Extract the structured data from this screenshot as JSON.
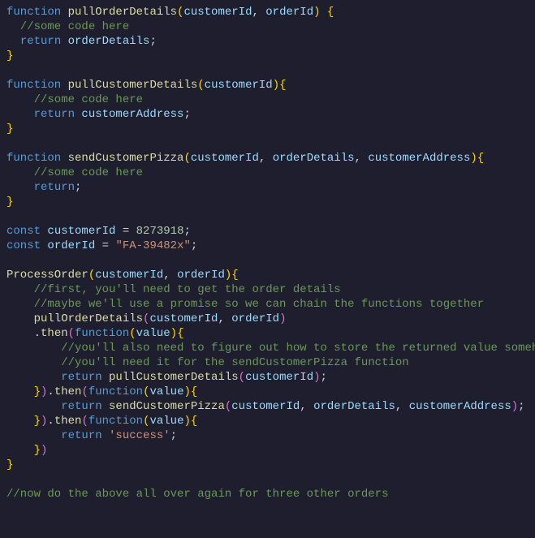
{
  "tokens": [
    [
      {
        "t": "function ",
        "c": "tok-kw"
      },
      {
        "t": "pullOrderDetails",
        "c": "tok-fn"
      },
      {
        "t": "(",
        "c": "tok-gold"
      },
      {
        "t": "customerId",
        "c": "tok-par"
      },
      {
        "t": ", ",
        "c": "tok-pun"
      },
      {
        "t": "orderId",
        "c": "tok-par"
      },
      {
        "t": ") ",
        "c": "tok-gold"
      },
      {
        "t": "{",
        "c": "tok-gold"
      }
    ],
    [
      {
        "t": "  //some code here",
        "c": "tok-com"
      }
    ],
    [
      {
        "t": "  ",
        "c": "tok-pun"
      },
      {
        "t": "return ",
        "c": "tok-kw"
      },
      {
        "t": "orderDetails",
        "c": "tok-par"
      },
      {
        "t": ";",
        "c": "tok-pun"
      }
    ],
    [
      {
        "t": "}",
        "c": "tok-gold"
      }
    ],
    [
      {
        "t": "",
        "c": "tok-pun"
      }
    ],
    [
      {
        "t": "function ",
        "c": "tok-kw"
      },
      {
        "t": "pullCustomerDetails",
        "c": "tok-fn"
      },
      {
        "t": "(",
        "c": "tok-gold"
      },
      {
        "t": "customerId",
        "c": "tok-par"
      },
      {
        "t": ")",
        "c": "tok-gold"
      },
      {
        "t": "{",
        "c": "tok-gold"
      }
    ],
    [
      {
        "t": "    //some code here",
        "c": "tok-com"
      }
    ],
    [
      {
        "t": "    ",
        "c": "tok-pun"
      },
      {
        "t": "return ",
        "c": "tok-kw"
      },
      {
        "t": "customerAddress",
        "c": "tok-par"
      },
      {
        "t": ";",
        "c": "tok-pun"
      }
    ],
    [
      {
        "t": "}",
        "c": "tok-gold"
      }
    ],
    [
      {
        "t": "",
        "c": "tok-pun"
      }
    ],
    [
      {
        "t": "function ",
        "c": "tok-kw"
      },
      {
        "t": "sendCustomerPizza",
        "c": "tok-fn"
      },
      {
        "t": "(",
        "c": "tok-gold"
      },
      {
        "t": "customerId",
        "c": "tok-par"
      },
      {
        "t": ", ",
        "c": "tok-pun"
      },
      {
        "t": "orderDetails",
        "c": "tok-par"
      },
      {
        "t": ", ",
        "c": "tok-pun"
      },
      {
        "t": "customerAddress",
        "c": "tok-par"
      },
      {
        "t": ")",
        "c": "tok-gold"
      },
      {
        "t": "{",
        "c": "tok-gold"
      }
    ],
    [
      {
        "t": "    //some code here",
        "c": "tok-com"
      }
    ],
    [
      {
        "t": "    ",
        "c": "tok-pun"
      },
      {
        "t": "return",
        "c": "tok-kw"
      },
      {
        "t": ";",
        "c": "tok-pun"
      }
    ],
    [
      {
        "t": "}",
        "c": "tok-gold"
      }
    ],
    [
      {
        "t": "",
        "c": "tok-pun"
      }
    ],
    [
      {
        "t": "const ",
        "c": "tok-kw"
      },
      {
        "t": "customerId",
        "c": "tok-par"
      },
      {
        "t": " = ",
        "c": "tok-pun"
      },
      {
        "t": "8273918",
        "c": "tok-num"
      },
      {
        "t": ";",
        "c": "tok-pun"
      }
    ],
    [
      {
        "t": "const ",
        "c": "tok-kw"
      },
      {
        "t": "orderId",
        "c": "tok-par"
      },
      {
        "t": " = ",
        "c": "tok-pun"
      },
      {
        "t": "\"FA-39482x\"",
        "c": "tok-str"
      },
      {
        "t": ";",
        "c": "tok-pun"
      }
    ],
    [
      {
        "t": "",
        "c": "tok-pun"
      }
    ],
    [
      {
        "t": "ProcessOrder",
        "c": "tok-fn"
      },
      {
        "t": "(",
        "c": "tok-gold"
      },
      {
        "t": "customerId",
        "c": "tok-par"
      },
      {
        "t": ", ",
        "c": "tok-pun"
      },
      {
        "t": "orderId",
        "c": "tok-par"
      },
      {
        "t": ")",
        "c": "tok-gold"
      },
      {
        "t": "{",
        "c": "tok-gold"
      }
    ],
    [
      {
        "t": "    //first, you'll need to get the order details",
        "c": "tok-com"
      }
    ],
    [
      {
        "t": "    //maybe we'll use a promise so we can chain the functions together",
        "c": "tok-com"
      }
    ],
    [
      {
        "t": "    ",
        "c": "tok-pun"
      },
      {
        "t": "pullOrderDetails",
        "c": "tok-fn"
      },
      {
        "t": "(",
        "c": "tok-pink"
      },
      {
        "t": "customerId",
        "c": "tok-par"
      },
      {
        "t": ", ",
        "c": "tok-pun"
      },
      {
        "t": "orderId",
        "c": "tok-par"
      },
      {
        "t": ")",
        "c": "tok-pink"
      }
    ],
    [
      {
        "t": "    .",
        "c": "tok-pun"
      },
      {
        "t": "then",
        "c": "tok-fn"
      },
      {
        "t": "(",
        "c": "tok-pink"
      },
      {
        "t": "function",
        "c": "tok-kw"
      },
      {
        "t": "(",
        "c": "tok-gold"
      },
      {
        "t": "value",
        "c": "tok-par"
      },
      {
        "t": ")",
        "c": "tok-gold"
      },
      {
        "t": "{",
        "c": "tok-gold"
      }
    ],
    [
      {
        "t": "        //you'll also need to figure out how to store the returned value somehow",
        "c": "tok-com"
      }
    ],
    [
      {
        "t": "        //you'll need it for the sendCustomerPizza function",
        "c": "tok-com"
      }
    ],
    [
      {
        "t": "        ",
        "c": "tok-pun"
      },
      {
        "t": "return ",
        "c": "tok-kw"
      },
      {
        "t": "pullCustomerDetails",
        "c": "tok-fn"
      },
      {
        "t": "(",
        "c": "tok-pink"
      },
      {
        "t": "customerId",
        "c": "tok-par"
      },
      {
        "t": ")",
        "c": "tok-pink"
      },
      {
        "t": ";",
        "c": "tok-pun"
      }
    ],
    [
      {
        "t": "    ",
        "c": "tok-pun"
      },
      {
        "t": "}",
        "c": "tok-gold"
      },
      {
        "t": ")",
        "c": "tok-pink"
      },
      {
        "t": ".",
        "c": "tok-pun"
      },
      {
        "t": "then",
        "c": "tok-fn"
      },
      {
        "t": "(",
        "c": "tok-pink"
      },
      {
        "t": "function",
        "c": "tok-kw"
      },
      {
        "t": "(",
        "c": "tok-gold"
      },
      {
        "t": "value",
        "c": "tok-par"
      },
      {
        "t": ")",
        "c": "tok-gold"
      },
      {
        "t": "{",
        "c": "tok-gold"
      }
    ],
    [
      {
        "t": "        ",
        "c": "tok-pun"
      },
      {
        "t": "return ",
        "c": "tok-kw"
      },
      {
        "t": "sendCustomerPizza",
        "c": "tok-fn"
      },
      {
        "t": "(",
        "c": "tok-pink"
      },
      {
        "t": "customerId",
        "c": "tok-par"
      },
      {
        "t": ", ",
        "c": "tok-pun"
      },
      {
        "t": "orderDetails",
        "c": "tok-par"
      },
      {
        "t": ", ",
        "c": "tok-pun"
      },
      {
        "t": "customerAddress",
        "c": "tok-par"
      },
      {
        "t": ")",
        "c": "tok-pink"
      },
      {
        "t": ";",
        "c": "tok-pun"
      }
    ],
    [
      {
        "t": "    ",
        "c": "tok-pun"
      },
      {
        "t": "}",
        "c": "tok-gold"
      },
      {
        "t": ")",
        "c": "tok-pink"
      },
      {
        "t": ".",
        "c": "tok-pun"
      },
      {
        "t": "then",
        "c": "tok-fn"
      },
      {
        "t": "(",
        "c": "tok-pink"
      },
      {
        "t": "function",
        "c": "tok-kw"
      },
      {
        "t": "(",
        "c": "tok-gold"
      },
      {
        "t": "value",
        "c": "tok-par"
      },
      {
        "t": ")",
        "c": "tok-gold"
      },
      {
        "t": "{",
        "c": "tok-gold"
      }
    ],
    [
      {
        "t": "        ",
        "c": "tok-pun"
      },
      {
        "t": "return ",
        "c": "tok-kw"
      },
      {
        "t": "'success'",
        "c": "tok-str"
      },
      {
        "t": ";",
        "c": "tok-pun"
      }
    ],
    [
      {
        "t": "    ",
        "c": "tok-pun"
      },
      {
        "t": "}",
        "c": "tok-gold"
      },
      {
        "t": ")",
        "c": "tok-pink"
      }
    ],
    [
      {
        "t": "}",
        "c": "tok-gold"
      }
    ],
    [
      {
        "t": "",
        "c": "tok-pun"
      }
    ],
    [
      {
        "t": "//now do the above all over again for three other orders",
        "c": "tok-com"
      }
    ]
  ]
}
